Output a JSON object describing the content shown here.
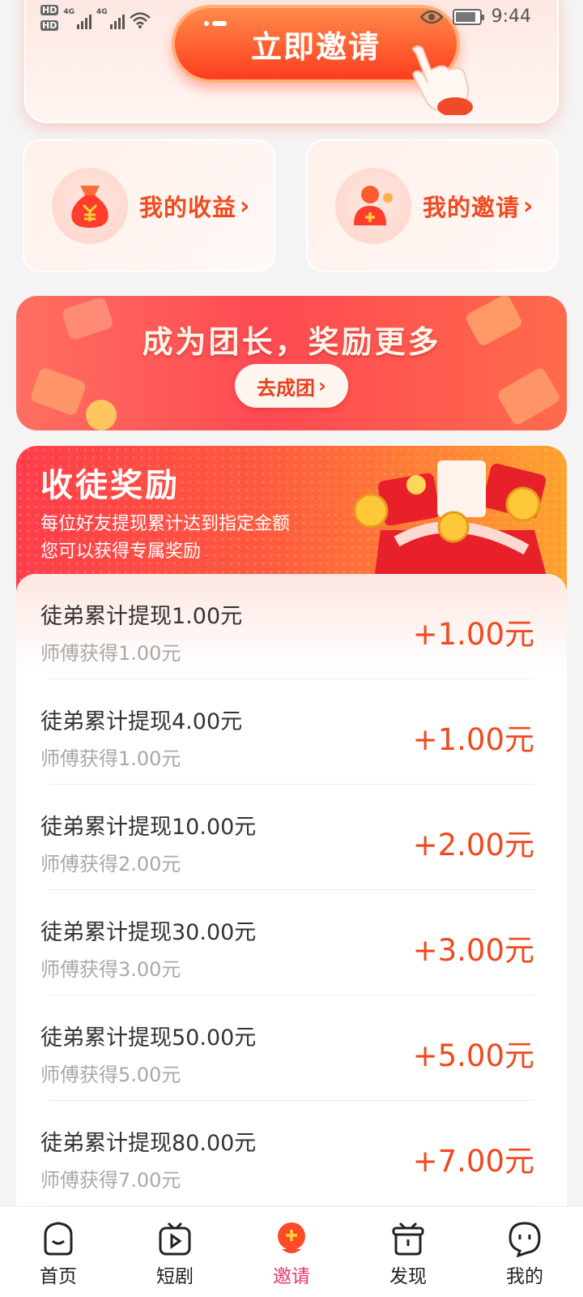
{
  "status_bar": {
    "hd1": "HD",
    "hd2": "HD",
    "net1": "4G",
    "net2": "4G",
    "time": "9:44"
  },
  "invite": {
    "button_label": "立即邀请"
  },
  "quick_cards": [
    {
      "label": "我的收益",
      "icon": "money-bag-icon"
    },
    {
      "label": "我的邀请",
      "icon": "user-plus-icon"
    }
  ],
  "banner": {
    "title": "成为团长，奖励更多",
    "button_label": "去成团"
  },
  "rewards": {
    "title": "收徒奖励",
    "subtitle_line1": "每位好友提现累计达到指定金额",
    "subtitle_line2": "您可以获得专属奖励",
    "items": [
      {
        "main": "徒弟累计提现1.00元",
        "sub": "师傅获得1.00元",
        "amount": "+1.00元"
      },
      {
        "main": "徒弟累计提现4.00元",
        "sub": "师傅获得1.00元",
        "amount": "+1.00元"
      },
      {
        "main": "徒弟累计提现10.00元",
        "sub": "师傅获得2.00元",
        "amount": "+2.00元"
      },
      {
        "main": "徒弟累计提现30.00元",
        "sub": "师傅获得3.00元",
        "amount": "+3.00元"
      },
      {
        "main": "徒弟累计提现50.00元",
        "sub": "师傅获得5.00元",
        "amount": "+5.00元"
      },
      {
        "main": "徒弟累计提现80.00元",
        "sub": "师傅获得7.00元",
        "amount": "+7.00元"
      }
    ]
  },
  "bottom_nav": {
    "items": [
      {
        "label": "首页",
        "icon": "home-icon",
        "active": false
      },
      {
        "label": "短剧",
        "icon": "tv-play-icon",
        "active": false
      },
      {
        "label": "邀请",
        "icon": "invite-icon",
        "active": true
      },
      {
        "label": "发现",
        "icon": "discover-box-icon",
        "active": false
      },
      {
        "label": "我的",
        "icon": "profile-icon",
        "active": false
      }
    ]
  },
  "colors": {
    "accent": "#ef4a1e",
    "nav_active": "#e83a6a"
  }
}
